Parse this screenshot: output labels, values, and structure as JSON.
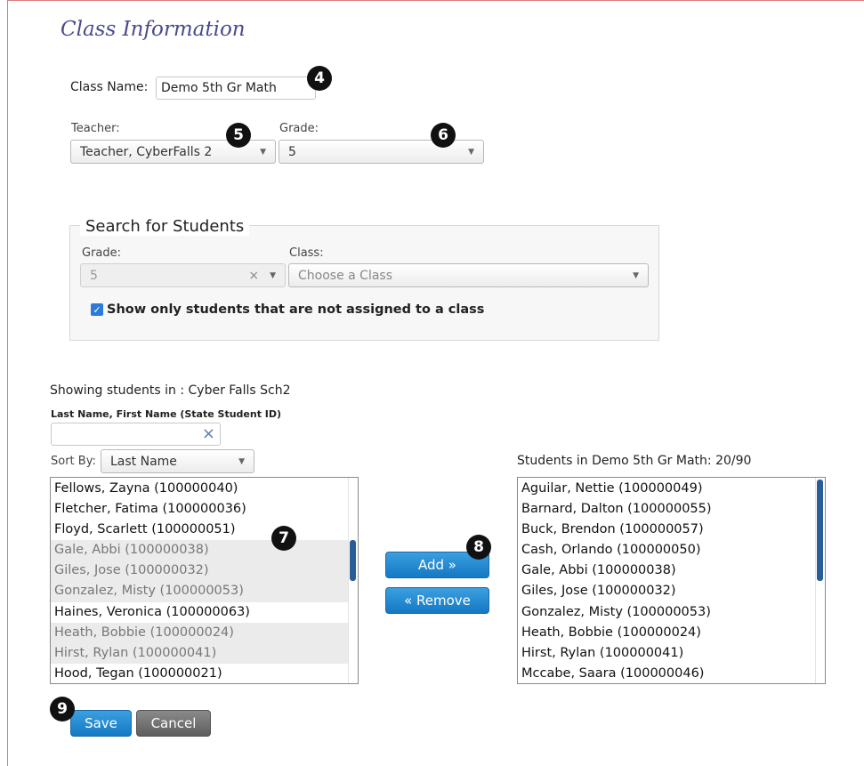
{
  "header": {
    "title": "Class Information"
  },
  "class_name": {
    "label": "Class Name:",
    "value": "Demo 5th Gr Math"
  },
  "teacher": {
    "label": "Teacher:",
    "selected": "Teacher, CyberFalls 2"
  },
  "grade": {
    "label": "Grade:",
    "selected": "5"
  },
  "search": {
    "legend": "Search for Students",
    "grade_label": "Grade:",
    "grade_selected": "5",
    "grade_clear": "×",
    "class_label": "Class:",
    "class_placeholder": "Choose a Class",
    "unassigned_only_label": "Show only students that are not assigned to a class",
    "unassigned_only_checked": true
  },
  "available": {
    "showing_label": "Showing students in : Cyber Falls Sch2",
    "filter_label": "Last Name, First Name (State Student ID)",
    "filter_value": "",
    "filter_clear": "×",
    "sort_label": "Sort By:",
    "sort_selected": "Last Name",
    "students": [
      {
        "name": "Fellows, Zayna (100000040)",
        "assigned": false
      },
      {
        "name": "Fletcher, Fatima (100000036)",
        "assigned": false
      },
      {
        "name": "Floyd, Scarlett (100000051)",
        "assigned": false
      },
      {
        "name": "Gale, Abbi (100000038)",
        "assigned": true
      },
      {
        "name": "Giles, Jose (100000032)",
        "assigned": true
      },
      {
        "name": "Gonzalez, Misty (100000053)",
        "assigned": true
      },
      {
        "name": "Haines, Veronica (100000063)",
        "assigned": false
      },
      {
        "name": "Heath, Bobbie (100000024)",
        "assigned": true
      },
      {
        "name": "Hirst, Rylan (100000041)",
        "assigned": true
      },
      {
        "name": "Hood, Tegan (100000021)",
        "assigned": false
      }
    ]
  },
  "actions": {
    "add_label": "Add »",
    "remove_label": "« Remove"
  },
  "enrolled": {
    "heading": "Students in Demo 5th Gr Math: 20/90",
    "students": [
      "Aguilar, Nettie (100000049)",
      "Barnard, Dalton (100000055)",
      "Buck, Brendon (100000057)",
      "Cash, Orlando (100000050)",
      "Gale, Abbi (100000038)",
      "Giles, Jose (100000032)",
      "Gonzalez, Misty (100000053)",
      "Heath, Bobbie (100000024)",
      "Hirst, Rylan (100000041)",
      "Mccabe, Saara (100000046)"
    ]
  },
  "footer": {
    "save_label": "Save",
    "cancel_label": "Cancel"
  },
  "callouts": [
    "4",
    "5",
    "6",
    "7",
    "8",
    "9"
  ],
  "colors": {
    "title": "#4a4a8c",
    "primary_button": "#1479c4",
    "scroll_thumb": "#2a5c97",
    "checkbox": "#2b7bd8"
  }
}
